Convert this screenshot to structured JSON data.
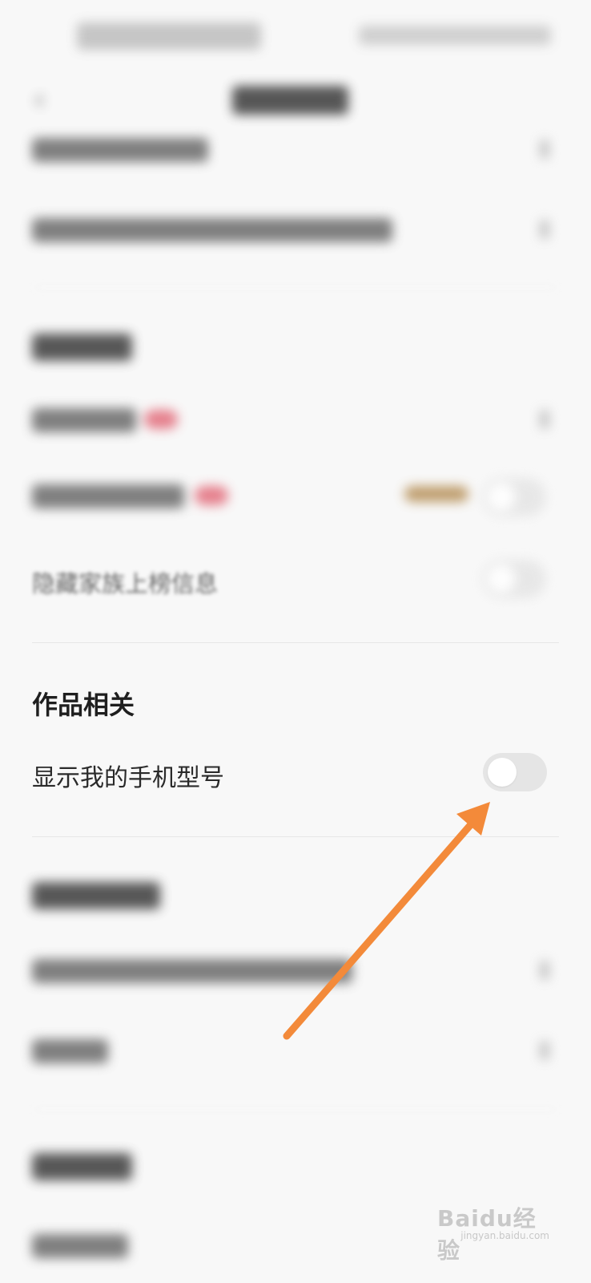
{
  "works_section": {
    "title": "作品相关",
    "show_phone_model_label": "显示我的手机型号",
    "show_phone_model_toggle": false
  },
  "blurred_row_label": "隐藏家族上榜信息",
  "watermark": {
    "brand": "Baidu经验",
    "sub": "jingyan.baidu.com"
  },
  "colors": {
    "arrow": "#F38A3A",
    "toggle_off": "#E5E5E5",
    "badge": "#E26B7A"
  }
}
